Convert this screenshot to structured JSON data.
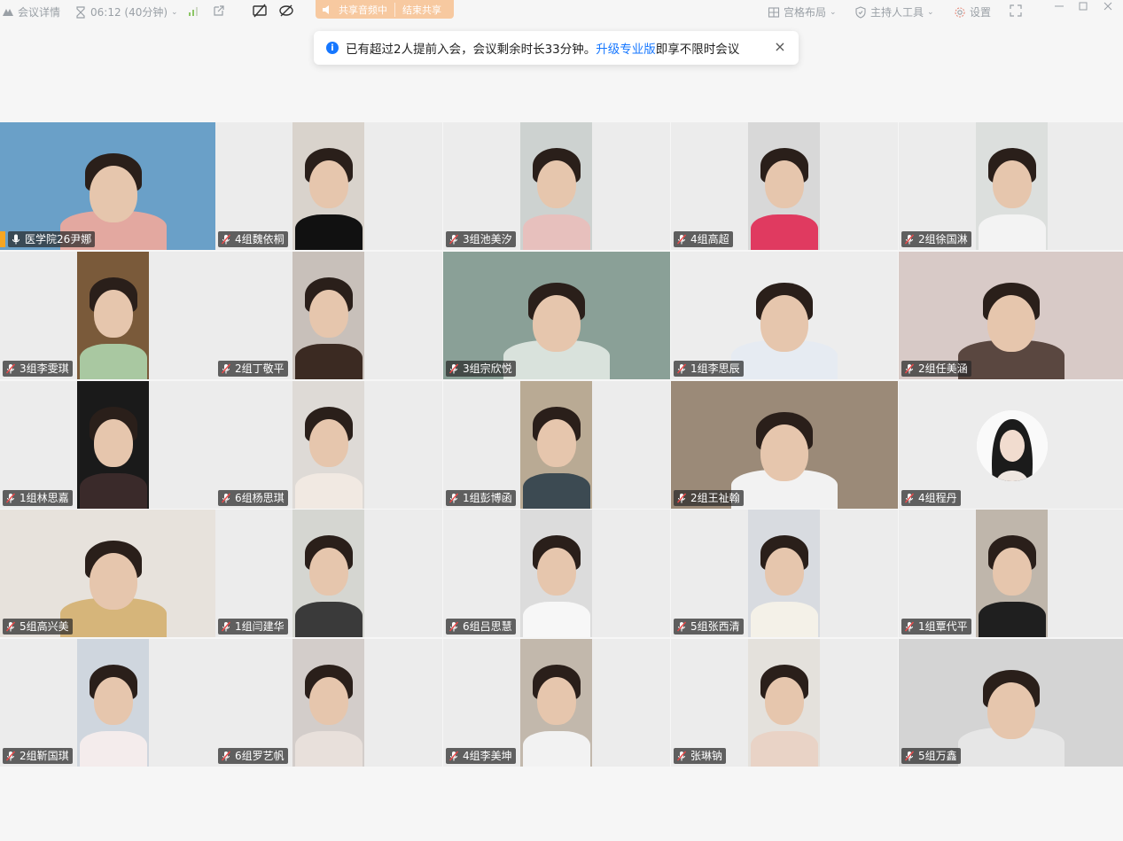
{
  "toolbar": {
    "meeting_info": "会议详情",
    "timer": "06:12 (40分钟)",
    "share_status": "共享音频中",
    "stop_share": "结束共享",
    "layout": "宫格布局",
    "host_tools": "主持人工具",
    "settings": "设置"
  },
  "notice": {
    "text_before": "已有超过2人提前入会，会议剩余时长33分钟。",
    "link": "升级专业版",
    "text_after": "即享不限时会议",
    "close": "×"
  },
  "participants": [
    {
      "name": "医学院26尹娜",
      "mic": "on",
      "bg": "#6aa0c8",
      "shirt": "#e3a8a0"
    },
    {
      "name": "4组魏依桐",
      "mic": "off",
      "bg": "#d9d3cc",
      "shirt": "#111111"
    },
    {
      "name": "3组池美汐",
      "mic": "off",
      "bg": "#cdd2d0",
      "shirt": "#e7c0bd"
    },
    {
      "name": "4组高超",
      "mic": "off",
      "bg": "#d8d8d8",
      "shirt": "#e03a60"
    },
    {
      "name": "2组徐国淋",
      "mic": "off",
      "bg": "#dcdfdd",
      "shirt": "#f3f3f3"
    },
    {
      "name": "3组李雯琪",
      "mic": "off",
      "bg": "#7a5a3a",
      "shirt": "#a9c8a1"
    },
    {
      "name": "2组丁敬平",
      "mic": "off",
      "bg": "#c8c0ba",
      "shirt": "#3b2a22"
    },
    {
      "name": "3组宗欣悦",
      "mic": "off",
      "bg": "#8aa097",
      "shirt": "#d9e2dc"
    },
    {
      "name": "1组李思辰",
      "mic": "off",
      "bg": "#ededed",
      "shirt": "#e6ebf2"
    },
    {
      "name": "2组任美涵",
      "mic": "off",
      "bg": "#d8cac7",
      "shirt": "#5a4740"
    },
    {
      "name": "1组林思嘉",
      "mic": "off",
      "bg": "#1a1a1a",
      "shirt": "#3a2a2a"
    },
    {
      "name": "6组杨思琪",
      "mic": "off",
      "bg": "#dedad6",
      "shirt": "#f1e9e2"
    },
    {
      "name": "1组彭博函",
      "mic": "off",
      "bg": "#b9aa94",
      "shirt": "#3c4a52"
    },
    {
      "name": "2组王祉翰",
      "mic": "off",
      "bg": "#9b8a78",
      "shirt": "#f2f2f2"
    },
    {
      "name": "4组程丹",
      "mic": "off",
      "bg": "#ffffff",
      "shirt": "#f2f2f2",
      "avatar": true
    },
    {
      "name": "5组高兴美",
      "mic": "off",
      "bg": "#e7e2dc",
      "shirt": "#d6b57a"
    },
    {
      "name": "1组闫建华",
      "mic": "off",
      "bg": "#d5d6d1",
      "shirt": "#3a3a3a"
    },
    {
      "name": "6组吕思慧",
      "mic": "off",
      "bg": "#dcdcdc",
      "shirt": "#f7f7f7"
    },
    {
      "name": "5组张西清",
      "mic": "off",
      "bg": "#d8dbe0",
      "shirt": "#f4f1e8"
    },
    {
      "name": "1组覃代平",
      "mic": "off",
      "bg": "#bfb6ab",
      "shirt": "#1f1f1f"
    },
    {
      "name": "2组靳国琪",
      "mic": "off",
      "bg": "#cfd6de",
      "shirt": "#f4ecec"
    },
    {
      "name": "6组罗艺帆",
      "mic": "off",
      "bg": "#d3cdca",
      "shirt": "#e8e0db"
    },
    {
      "name": "4组李美坤",
      "mic": "off",
      "bg": "#c2b8ac",
      "shirt": "#f2f2f2"
    },
    {
      "name": "张琳钠",
      "mic": "off",
      "bg": "#e4e1dc",
      "shirt": "#e9d3c6"
    },
    {
      "name": "5组万鑫",
      "mic": "off",
      "bg": "#d4d4d4",
      "shirt": "#e6e6e6"
    }
  ],
  "video_modes": [
    "full",
    "portrait",
    "portrait",
    "portrait",
    "portrait",
    "portrait",
    "portrait",
    "full",
    "full",
    "full",
    "portrait",
    "portrait",
    "portrait",
    "full",
    "avatar",
    "full",
    "portrait",
    "portrait",
    "portrait",
    "portrait",
    "portrait",
    "portrait",
    "portrait",
    "portrait",
    "full"
  ]
}
